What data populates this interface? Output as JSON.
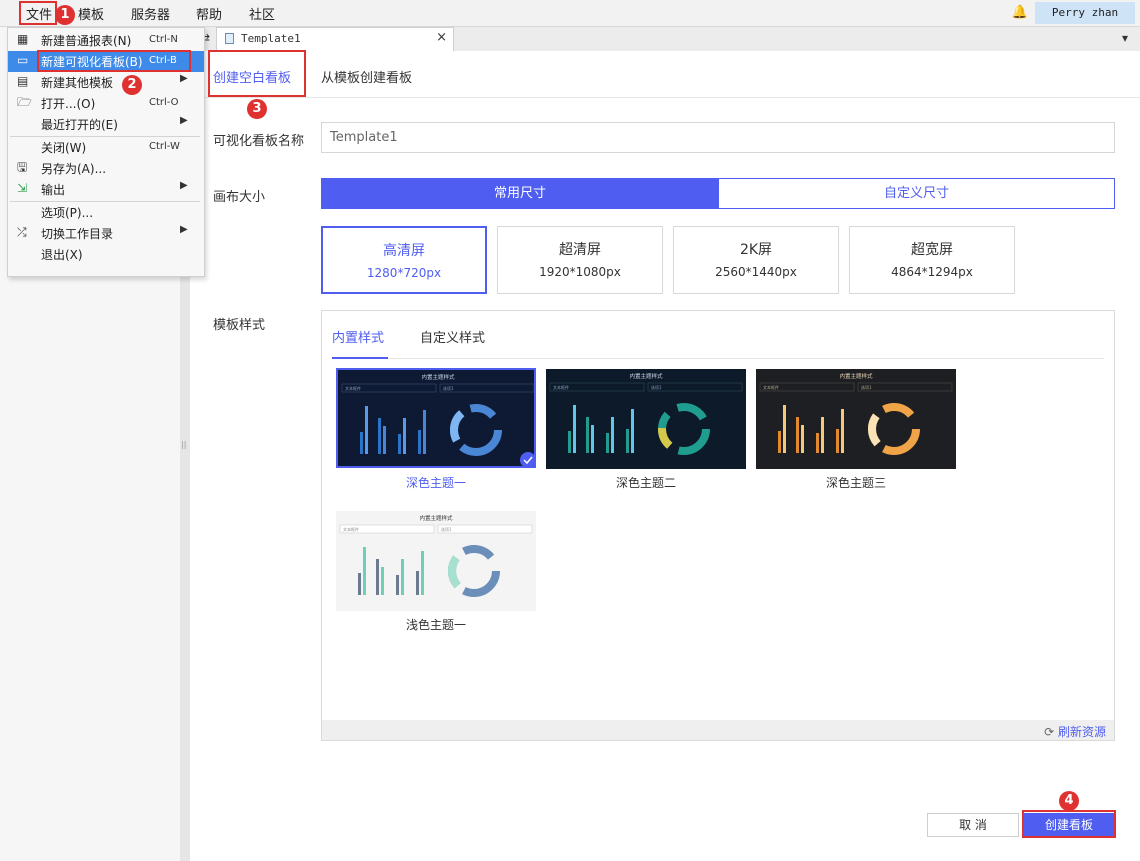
{
  "menubar": {
    "items": [
      "文件",
      "模板",
      "服务器",
      "帮助",
      "社区"
    ],
    "user": "Perry zhan"
  },
  "tabbar": {
    "tab_title": "Template1",
    "close": "×"
  },
  "dropdown": {
    "items": [
      {
        "label": "新建普通报表(N)",
        "shortcut": "Ctrl-N",
        "icon": "grid-report-icon"
      },
      {
        "label": "新建可视化看板(B)",
        "shortcut": "Ctrl-B",
        "icon": "dashboard-icon"
      },
      {
        "label": "新建其他模板",
        "shortcut": "",
        "icon": "template-icon",
        "submenu": true
      },
      {
        "label": "打开...(O)",
        "shortcut": "Ctrl-O",
        "icon": "folder-open-icon"
      },
      {
        "label": "最近打开的(E)",
        "shortcut": "",
        "icon": "",
        "submenu": true
      },
      {
        "label": "关闭(W)",
        "shortcut": "Ctrl-W",
        "icon": ""
      },
      {
        "label": "另存为(A)...",
        "shortcut": "",
        "icon": "save-as-icon"
      },
      {
        "label": "输出",
        "shortcut": "",
        "icon": "export-icon",
        "submenu": true
      },
      {
        "label": "选项(P)...",
        "shortcut": "",
        "icon": ""
      },
      {
        "label": "切换工作目录",
        "shortcut": "",
        "icon": "shuffle-icon",
        "submenu": true
      },
      {
        "label": "退出(X)",
        "shortcut": "",
        "icon": ""
      }
    ]
  },
  "annotations": [
    "1",
    "2",
    "3",
    "4"
  ],
  "dialog": {
    "tabs": [
      "创建空白看板",
      "从模板创建看板"
    ],
    "name_label": "可视化看板名称",
    "name_value": "Template1",
    "canvas_label": "画布大小",
    "size_tabs": [
      "常用尺寸",
      "自定义尺寸"
    ],
    "sizes": [
      {
        "name": "高清屏",
        "dim": "1280*720px",
        "selected": true
      },
      {
        "name": "超清屏",
        "dim": "1920*1080px",
        "selected": false
      },
      {
        "name": "2K屏",
        "dim": "2560*1440px",
        "selected": false
      },
      {
        "name": "超宽屏",
        "dim": "4864*1294px",
        "selected": false
      }
    ],
    "style_label": "模板样式",
    "style_tabs": [
      "内置样式",
      "自定义样式"
    ],
    "themes": [
      {
        "caption": "深色主题一",
        "selected": true
      },
      {
        "caption": "深色主题二",
        "selected": false
      },
      {
        "caption": "深色主题三",
        "selected": false
      },
      {
        "caption": "浅色主题一",
        "selected": false
      }
    ],
    "thumb_title": "内置主题样式",
    "thumb_filter": "文本框件",
    "thumb_select": "选项1",
    "refresh": "刷新资源",
    "cancel": "取 消",
    "create": "创建看板"
  },
  "colors": {
    "accent": "#4f5ef0",
    "annotation_red": "#e03131",
    "menu_highlight": "#3d8ae8"
  }
}
